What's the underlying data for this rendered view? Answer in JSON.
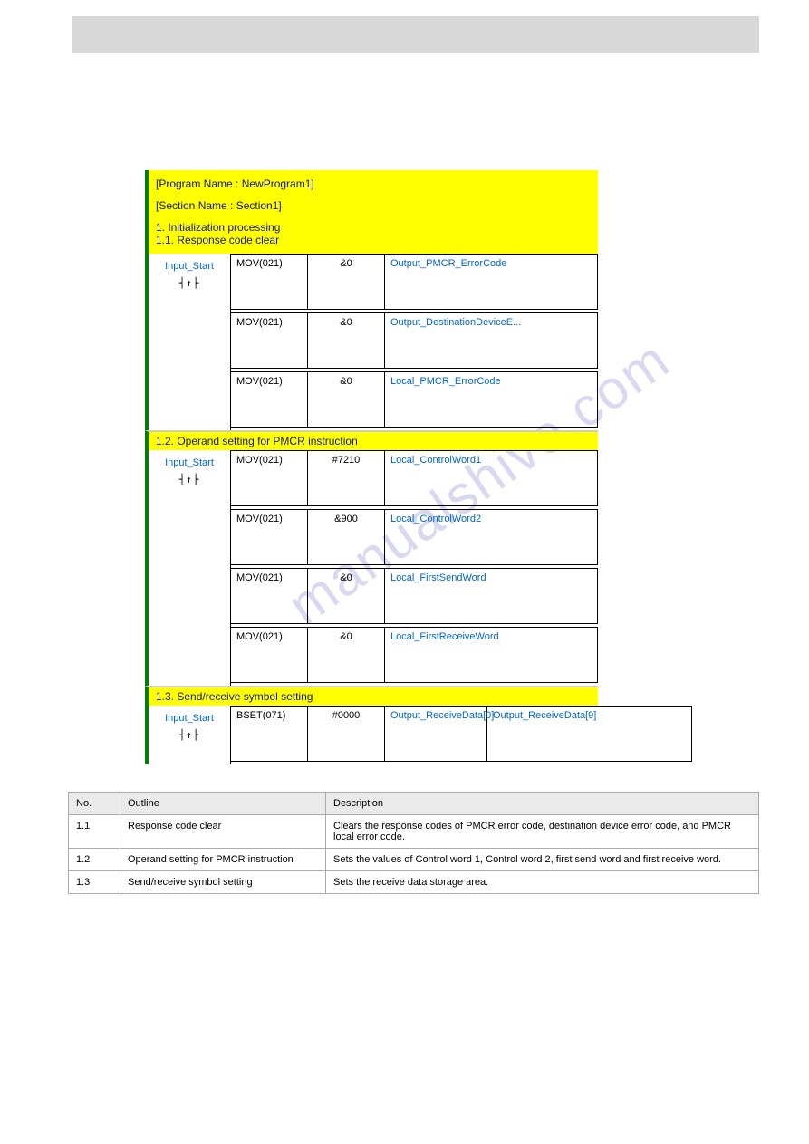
{
  "header": {
    "programName": "[Program Name : NewProgram1]",
    "sectionName": "[Section Name : Section1]",
    "heading1": "1. Initialization processing",
    "heading1_1": "1.1. Response code clear"
  },
  "section1_1": {
    "contact": "Input_Start",
    "symbol": "┤↑├",
    "rows": [
      {
        "op": "MOV(021)",
        "val": "&0",
        "sym": "Output_PMCR_ErrorCode"
      },
      {
        "op": "MOV(021)",
        "val": "&0",
        "sym": "Output_DestinationDeviceE..."
      },
      {
        "op": "MOV(021)",
        "val": "&0",
        "sym": "Local_PMCR_ErrorCode"
      }
    ]
  },
  "heading1_2": "1.2. Operand setting for PMCR instruction",
  "section1_2": {
    "contact": "Input_Start",
    "symbol": "┤↑├",
    "rows": [
      {
        "op": "MOV(021)",
        "val": "#7210",
        "sym": "Local_ControlWord1"
      },
      {
        "op": "MOV(021)",
        "val": "&900",
        "sym": "Local_ControlWord2"
      },
      {
        "op": "MOV(021)",
        "val": "&0",
        "sym": "Local_FirstSendWord"
      },
      {
        "op": "MOV(021)",
        "val": "&0",
        "sym": "Local_FirstReceiveWord"
      }
    ]
  },
  "heading1_3": "1.3. Send/receive symbol setting",
  "section1_3": {
    "contact": "Input_Start",
    "symbol": "┤↑├",
    "rows": [
      {
        "op": "BSET(071)",
        "val": "#0000",
        "sym": "Output_ReceiveData[0]",
        "sym2": "Output_ReceiveData[9]"
      }
    ]
  },
  "table": {
    "headers": [
      "No.",
      "Outline",
      "Description"
    ],
    "rows": [
      {
        "no": "1.1",
        "outline": "Response code clear",
        "desc": "Clears the response codes of PMCR error code, destination device error code, and PMCR local error code."
      },
      {
        "no": "1.2",
        "outline": "Operand setting for PMCR instruction",
        "desc": "Sets the values of Control word 1, Control word 2, first send word and first receive word."
      },
      {
        "no": "1.3",
        "outline": "Send/receive symbol setting",
        "desc": "Sets the receive data storage area."
      }
    ]
  },
  "watermark": "manualshive.com"
}
